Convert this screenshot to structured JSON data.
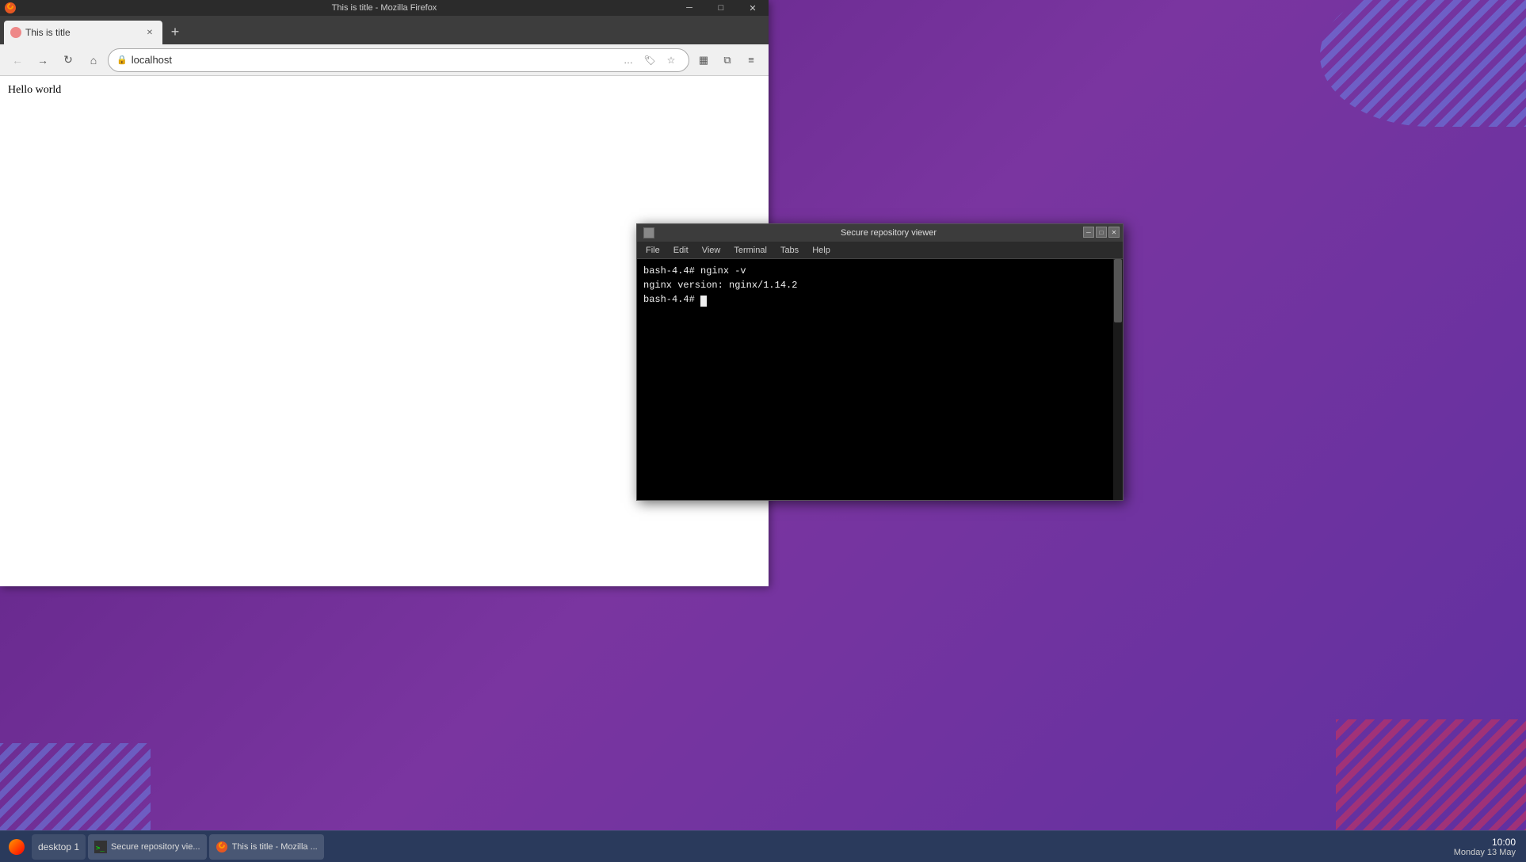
{
  "desktop": {
    "background_color": "#6a2d8f"
  },
  "firefox": {
    "titlebar_text": "This is title - Mozilla Firefox",
    "tab_title": "This is title",
    "address": "localhost",
    "page_body_text": "Hello world",
    "nav": {
      "back": "←",
      "forward": "→",
      "reload": "↺",
      "home": "⌂"
    },
    "toolbar_buttons": {
      "more": "…",
      "pocket": "🏷",
      "bookmark": "☆",
      "reading_list": "▦",
      "split": "⧉",
      "menu": "≡"
    },
    "new_tab": "+"
  },
  "terminal": {
    "title": "Secure repository viewer",
    "menu_items": [
      "File",
      "Edit",
      "View",
      "Terminal",
      "Tabs",
      "Help"
    ],
    "lines": [
      "bash-4.4# nginx -v",
      "nginx version: nginx/1.14.2",
      "bash-4.4# "
    ]
  },
  "taskbar": {
    "start_label": "desktop 1",
    "items": [
      {
        "id": "terminal",
        "label": "Secure repository vie..."
      },
      {
        "id": "firefox",
        "label": "This is title - Mozilla ..."
      }
    ],
    "clock": {
      "time": "10:00",
      "date": "Monday 13 May"
    }
  }
}
